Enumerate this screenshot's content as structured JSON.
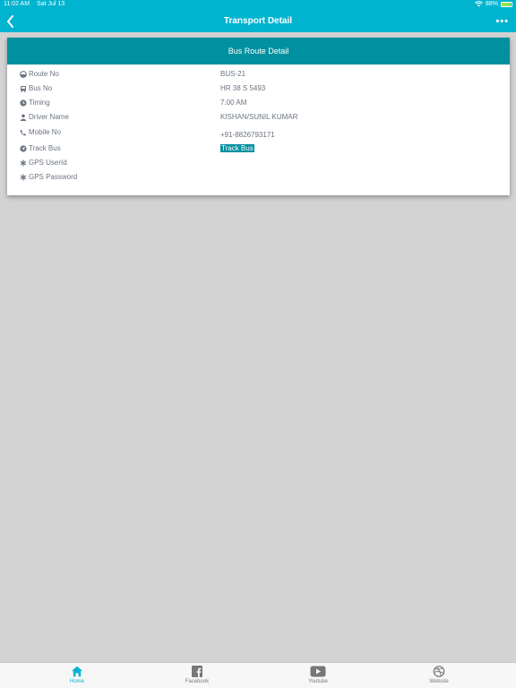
{
  "status_bar": {
    "time": "11:02 AM",
    "date": "Sat Jul 13",
    "battery": "88%",
    "battery_level": 0.88
  },
  "nav": {
    "title": "Transport Detail",
    "more": "•••"
  },
  "card": {
    "title": "Bus Route Detail",
    "rows": [
      {
        "label": "Route No",
        "value": "BUS-21",
        "icon": "route-icon"
      },
      {
        "label": "Bus No",
        "value": "HR 38 S 5493",
        "icon": "bus-icon"
      },
      {
        "label": "Timing",
        "value": "7.00 AM",
        "icon": "clock-icon"
      },
      {
        "label": "Driver Name",
        "value": "KISHAN/SUNIL KUMAR",
        "icon": "user-icon"
      },
      {
        "label": "Mobile No",
        "value": "+91-8826793171",
        "icon": "phone-icon"
      },
      {
        "label": "Track Bus",
        "value": "Track Bus",
        "icon": "location-icon"
      },
      {
        "label": "GPS UserId",
        "value": "",
        "icon": "asterisk-icon"
      },
      {
        "label": "GPS Password",
        "value": "",
        "icon": "asterisk-icon"
      }
    ]
  },
  "tabs": [
    {
      "label": "Home",
      "icon": "home-icon",
      "active": true
    },
    {
      "label": "Facebook",
      "icon": "facebook-icon",
      "active": false
    },
    {
      "label": "Youtube",
      "icon": "youtube-icon",
      "active": false
    },
    {
      "label": "Website",
      "icon": "dribbble-icon",
      "active": false
    }
  ],
  "colors": {
    "accent": "#00b4d0",
    "header": "#00909f",
    "background": "#d3d3d3"
  }
}
